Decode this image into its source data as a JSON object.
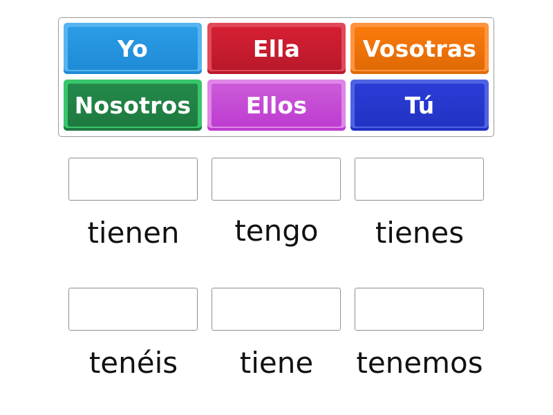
{
  "tiles": [
    {
      "label": "Yo",
      "color": "#2b9ce6",
      "edge": "#56b4ef",
      "dark": "#1f8bd6"
    },
    {
      "label": "Ella",
      "color": "#d61f33",
      "edge": "#e24a5a",
      "dark": "#b9192b"
    },
    {
      "label": "Vosotras",
      "color": "#fb7a0c",
      "edge": "#fd9440",
      "dark": "#e06a06"
    },
    {
      "label": "Nosotros",
      "color": "#23894a",
      "edge": "#38c56c",
      "dark": "#1e7a40"
    },
    {
      "label": "Ellos",
      "color": "#cc5bd9",
      "edge": "#df86e7",
      "dark": "#bd3cd0"
    },
    {
      "label": "Tú",
      "color": "#2a3cd6",
      "edge": "#5062e3",
      "dark": "#2233c4"
    }
  ],
  "targets": [
    {
      "label": "tienen",
      "value": ""
    },
    {
      "label": "tengo",
      "value": ""
    },
    {
      "label": "tienes",
      "value": ""
    },
    {
      "label": "tenéis",
      "value": ""
    },
    {
      "label": "tiene",
      "value": ""
    },
    {
      "label": "tenemos",
      "value": ""
    }
  ]
}
